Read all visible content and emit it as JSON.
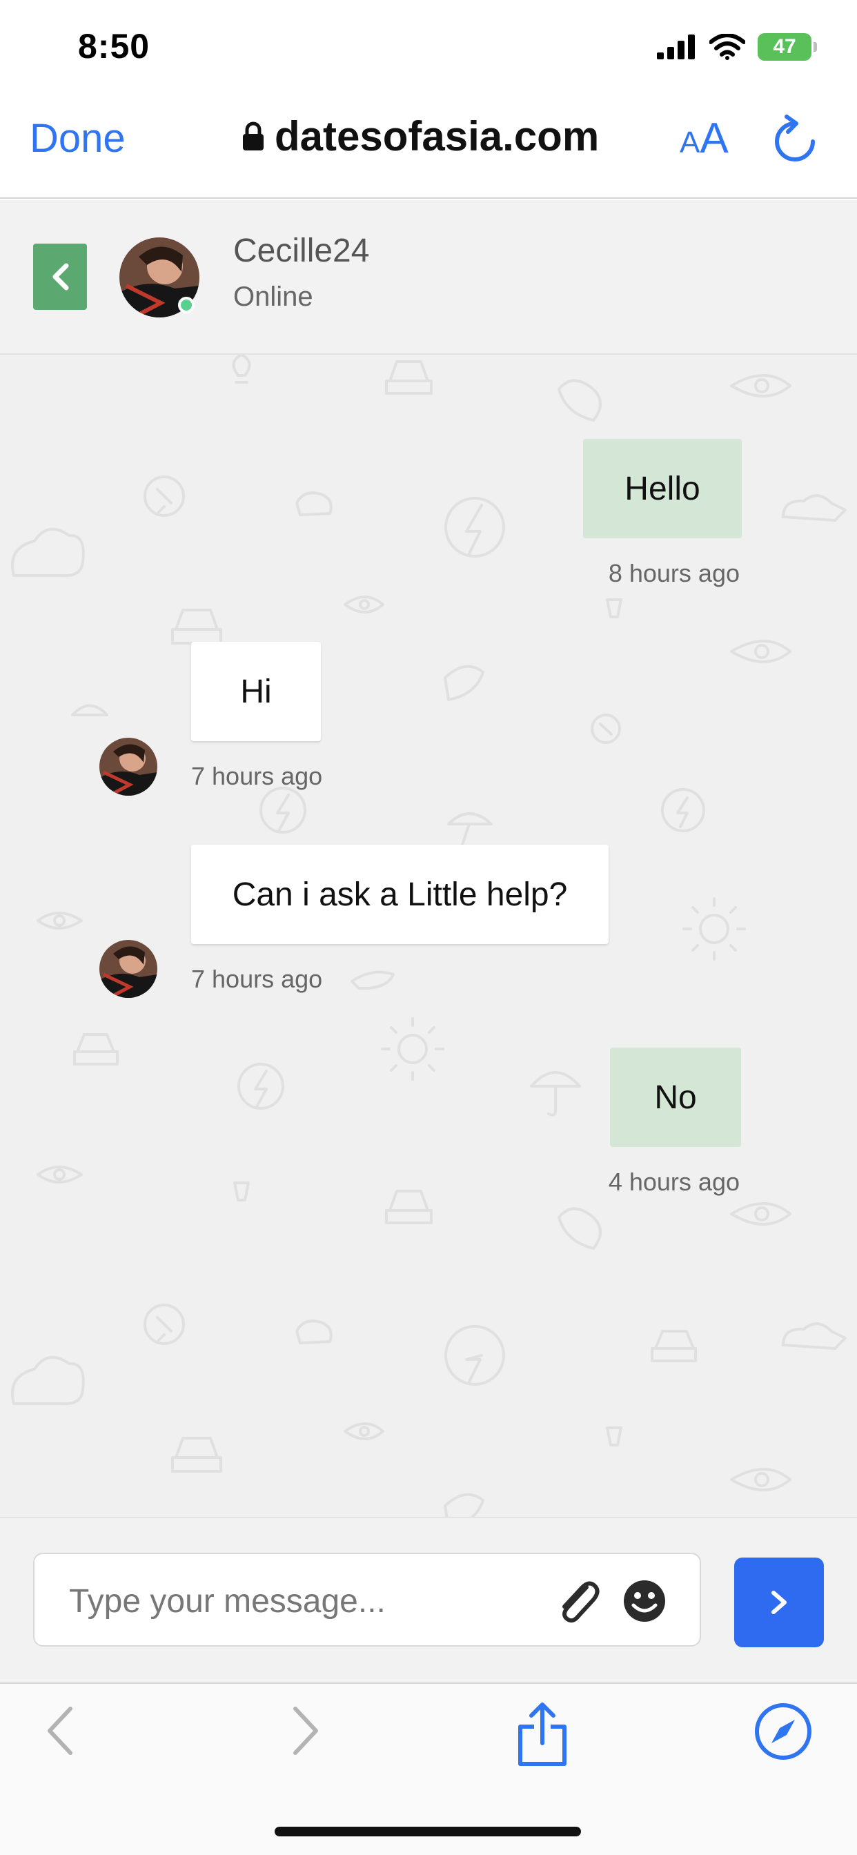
{
  "status_bar": {
    "time": "8:50",
    "battery": "47"
  },
  "safari": {
    "done_label": "Done",
    "url": "datesofasia.com",
    "text_size_label_small": "A",
    "text_size_label_large": "A"
  },
  "chat_header": {
    "contact_name": "Cecille24",
    "status": "Online"
  },
  "messages": [
    {
      "direction": "sent",
      "text": "Hello",
      "time": "8 hours ago"
    },
    {
      "direction": "received",
      "text": "Hi",
      "time": "7 hours ago"
    },
    {
      "direction": "received",
      "text": "Can i ask a Little help?",
      "time": "7 hours ago"
    },
    {
      "direction": "sent",
      "text": "No",
      "time": "4 hours ago"
    }
  ],
  "composer": {
    "placeholder": "Type your message..."
  },
  "colors": {
    "accent": "#2f74f0",
    "back_button": "#5ba870",
    "sent_bubble": "#d4e6d6",
    "online": "#58d08e",
    "send_button": "#2e6bf0"
  },
  "icons": [
    "lock-icon",
    "reload-icon",
    "back-arrow-icon",
    "paperclip-icon",
    "smiley-icon",
    "send-chevron-icon",
    "nav-back-icon",
    "nav-forward-icon",
    "share-icon",
    "compass-icon"
  ]
}
